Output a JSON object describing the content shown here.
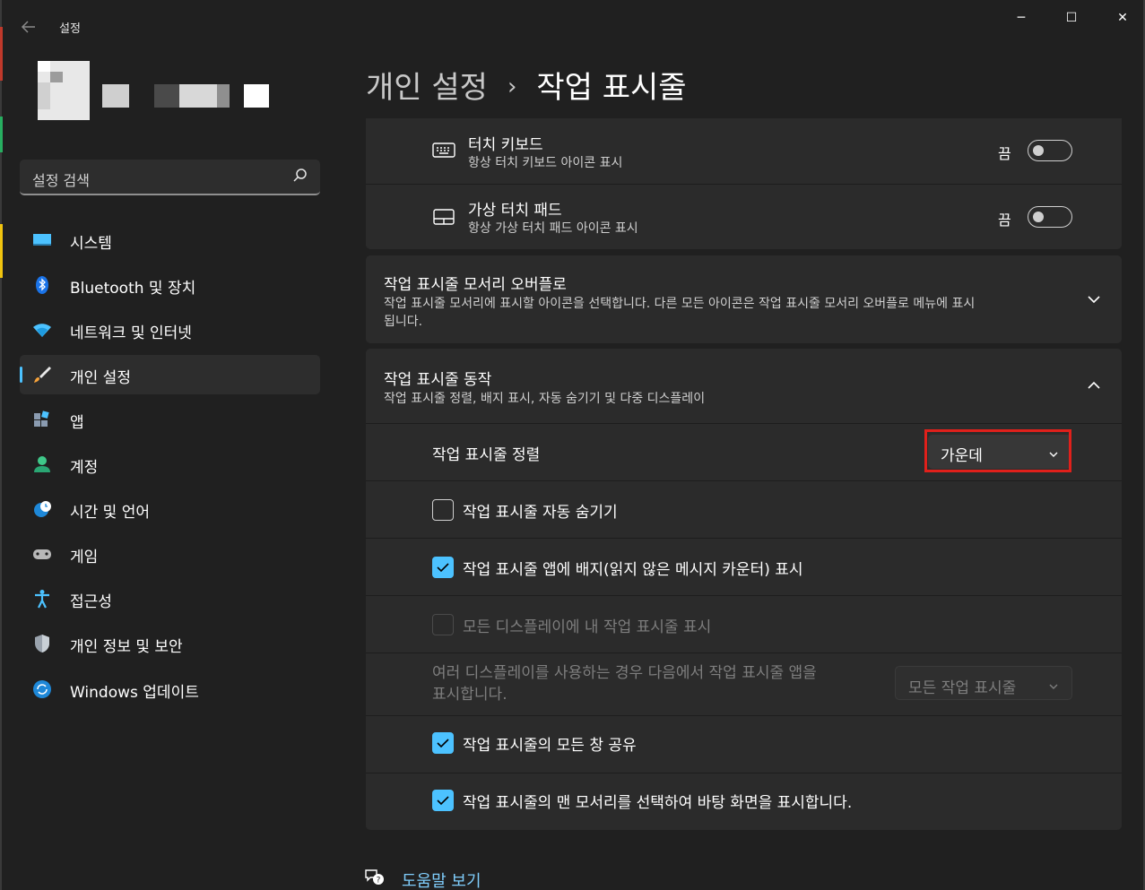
{
  "window": {
    "app_title": "설정",
    "back_icon": "back-arrow-icon",
    "minimize_glyph": "─",
    "maximize_glyph": "☐",
    "close_glyph": "✕"
  },
  "sidebar": {
    "search_placeholder": "설정 검색",
    "items": [
      {
        "label": "시스템",
        "icon": "system-monitor-icon",
        "active": false
      },
      {
        "label": "Bluetooth 및 장치",
        "icon": "bluetooth-icon",
        "active": false
      },
      {
        "label": "네트워크 및 인터넷",
        "icon": "wifi-icon",
        "active": false
      },
      {
        "label": "개인 설정",
        "icon": "paintbrush-icon",
        "active": true
      },
      {
        "label": "앱",
        "icon": "apps-icon",
        "active": false
      },
      {
        "label": "계정",
        "icon": "account-icon",
        "active": false
      },
      {
        "label": "시간 및 언어",
        "icon": "globe-clock-icon",
        "active": false
      },
      {
        "label": "게임",
        "icon": "gamepad-icon",
        "active": false
      },
      {
        "label": "접근성",
        "icon": "accessibility-icon",
        "active": false
      },
      {
        "label": "개인 정보 및 보안",
        "icon": "shield-icon",
        "active": false
      },
      {
        "label": "Windows 업데이트",
        "icon": "windows-update-icon",
        "active": false
      }
    ]
  },
  "header": {
    "parent": "개인 설정",
    "separator": "›",
    "current": "작업 표시줄"
  },
  "corner_icons": {
    "touch_keyboard": {
      "title": "터치 키보드",
      "subtitle": "항상 터치 키보드 아이콘 표시",
      "state_label": "끔",
      "on": false
    },
    "virtual_touchpad": {
      "title": "가상 터치 패드",
      "subtitle": "항상 가상 터치 패드 아이콘 표시",
      "state_label": "끔",
      "on": false
    }
  },
  "overflow": {
    "title": "작업 표시줄 모서리 오버플로",
    "subtitle_line1": "작업 표시줄 모서리에 표시할 아이콘을 선택합니다. 다른 모든 아이콘은 작업 표시줄 모서리 오버플로 메뉴에 표시",
    "subtitle_line2": "됩니다.",
    "expanded": false
  },
  "behaviors": {
    "title": "작업 표시줄 동작",
    "subtitle": "작업 표시줄 정렬, 배지 표시, 자동 숨기기 및 다중 디스플레이",
    "expanded": true,
    "alignment_label": "작업 표시줄 정렬",
    "alignment_value": "가운데",
    "auto_hide": {
      "label": "작업 표시줄 자동 숨기기",
      "checked": false
    },
    "badges": {
      "label": "작업 표시줄 앱에 배지(읽지 않은 메시지 카운터) 표시",
      "checked": true
    },
    "all_displays": {
      "label": "모든 디스플레이에 내 작업 표시줄 표시",
      "checked": false,
      "disabled": true
    },
    "multi_display_line1": "여러 디스플레이를 사용하는 경우 다음에서 작업 표시줄 앱을",
    "multi_display_line2": "표시합니다.",
    "multi_display_value": "모든 작업 표시줄",
    "share_windows": {
      "label": "작업 표시줄의 모든 창 공유",
      "checked": true
    },
    "show_desktop": {
      "label": "작업 표시줄의 맨 모서리를 선택하여 바탕 화면을 표시합니다.",
      "checked": true
    }
  },
  "help": {
    "link_text": "도움말 보기",
    "icon": "help-chat-icon"
  },
  "colors": {
    "accent": "#4cc2ff",
    "background": "#202020",
    "card": "#2b2b2b",
    "highlight": "#e0201b"
  }
}
